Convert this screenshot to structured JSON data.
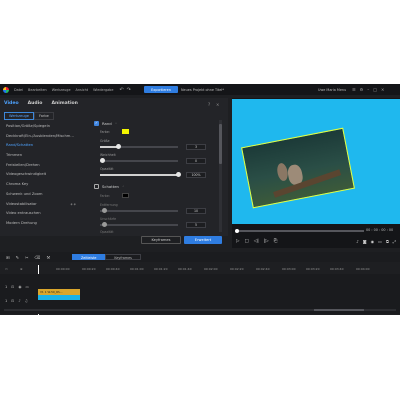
{
  "menubar": {
    "items": [
      "Datei",
      "Bearbeiten",
      "Werkzeuge",
      "Ansicht",
      "Wiedergabe"
    ],
    "export_label": "Exportieren",
    "project_title": "Neues Projekt ohne Titel*",
    "user_label": "Uwe Maria Menu"
  },
  "panel": {
    "tabs": [
      "Video",
      "Audio",
      "Animation"
    ],
    "subtabs": [
      "Werkzeuge",
      "Farbe"
    ],
    "tools": [
      {
        "label": "Position/Größe/Spiegeln",
        "starred": false
      },
      {
        "label": "Deckkraft/Ein-/Ausblenden/Mischm...",
        "starred": false
      },
      {
        "label": "Rand/Schatten",
        "starred": false
      },
      {
        "label": "Trimmen",
        "starred": false
      },
      {
        "label": "Freistellen/Drehen",
        "starred": false
      },
      {
        "label": "Videogeschwindigkeit",
        "starred": false
      },
      {
        "label": "Chroma Key",
        "starred": false
      },
      {
        "label": "Schwenk und Zoom",
        "starred": false
      },
      {
        "label": "Videostabilisator",
        "starred": true
      },
      {
        "label": "Video entrauschen",
        "starred": false
      },
      {
        "label": "Modern Drehung",
        "starred": false
      }
    ],
    "selected_tool": "Rand/Schatten",
    "border": {
      "label": "Rand",
      "enabled": true,
      "color_label": "Farbe:",
      "color": "#f3f500",
      "size_label": "Größe",
      "size_value": "3",
      "blur_label": "Weichheit",
      "blur_value": "0",
      "opacity_label": "Opazität",
      "opacity_value": "100%"
    },
    "shadow": {
      "label": "Schatten",
      "enabled": false,
      "color_label": "Farbe:",
      "color": "#000000",
      "distance_label": "Entfernung",
      "distance_value": "10",
      "blur_label": "Unschärfe",
      "blur_value": "5",
      "opacity_label": "Opazität"
    },
    "keyframes_button": "Keyframes",
    "advanced_button": "Erweitert"
  },
  "preview": {
    "timecode": "00 : 00 : 00 : 00",
    "border_color": "#e5ff3c",
    "background_color": "#1fb8ee"
  },
  "timeline": {
    "tabs": [
      "Zeitleiste",
      "Keyframes"
    ],
    "ruler": [
      "00:00:00",
      "00:00:20",
      "00:00:40",
      "00:01:00",
      "00:01:20",
      "00:01:40",
      "00:02:00",
      "00:02:20",
      "00:02:40",
      "00:03:00",
      "00:03:20",
      "00:03:40",
      "00:04:00"
    ],
    "tracks": [
      {
        "name": "1",
        "clip_label": "Vt. 1 W-50_RS..."
      },
      {
        "name": "1",
        "clip_label": ""
      }
    ]
  },
  "accent_color": "#2f7de1"
}
